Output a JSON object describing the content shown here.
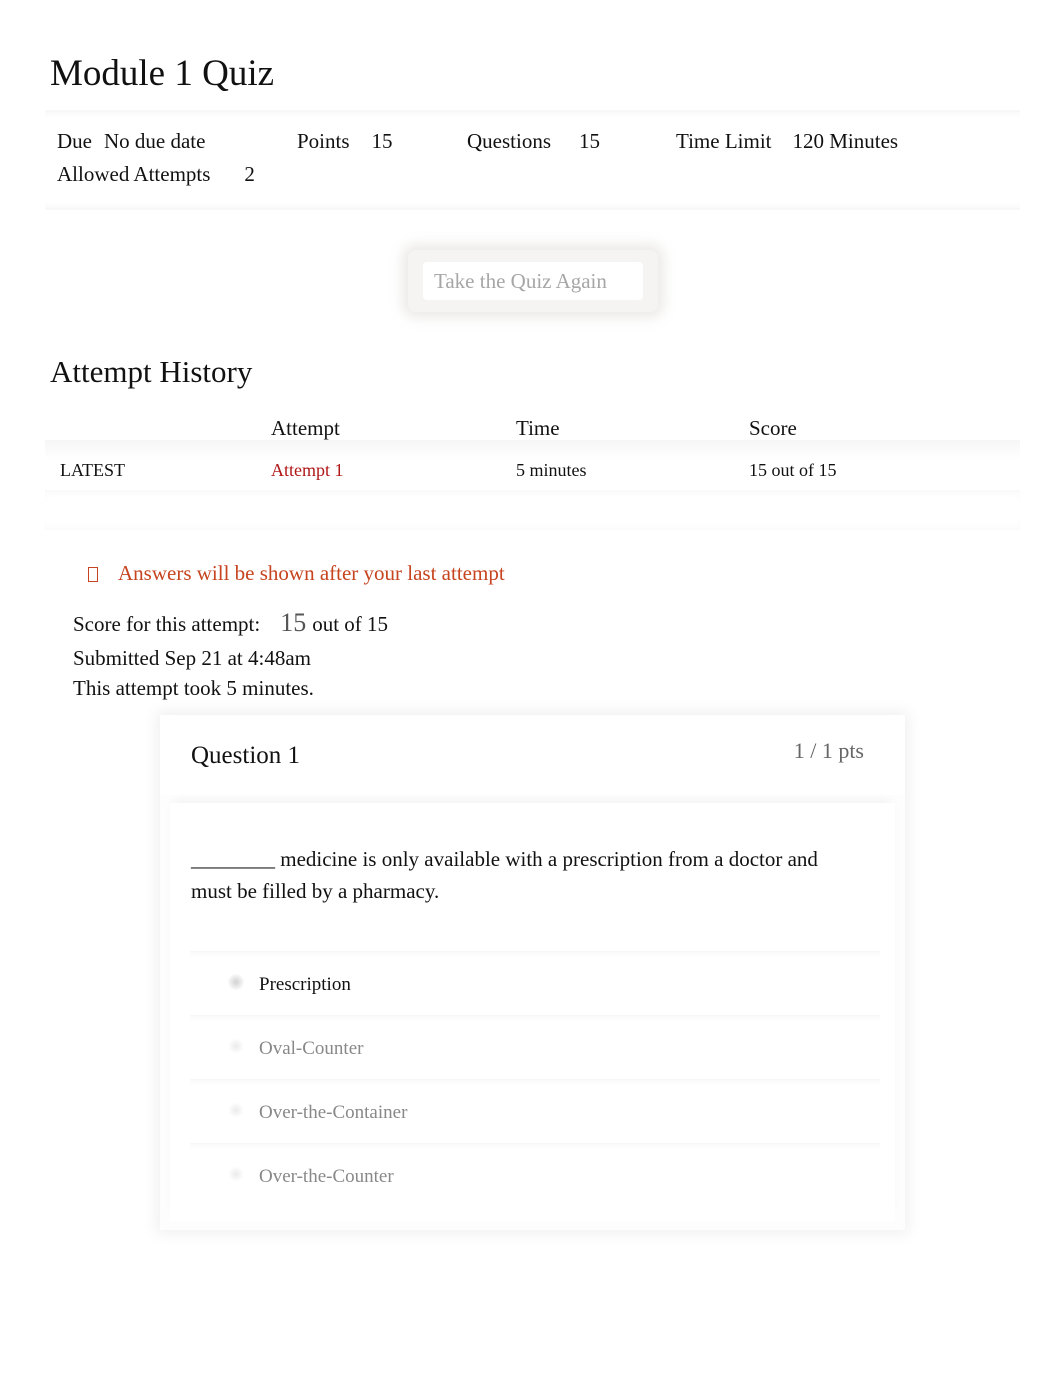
{
  "page": {
    "title": "Module 1 Quiz"
  },
  "details": [
    {
      "label": "Due",
      "value": "No due date"
    },
    {
      "label": "Points",
      "value": "15"
    },
    {
      "label": "Questions",
      "value": "15"
    },
    {
      "label": "Time Limit",
      "value": "120 Minutes"
    },
    {
      "label": "Allowed Attempts",
      "value": "2"
    }
  ],
  "actions": {
    "take_again_label": "Take the Quiz Again"
  },
  "attempt_history": {
    "heading": "Attempt History",
    "columns": [
      "",
      "Attempt",
      "Time",
      "Score"
    ],
    "rows": [
      {
        "tag": "LATEST",
        "attempt": "Attempt 1",
        "time": "5 minutes",
        "score": "15 out of 15"
      }
    ]
  },
  "notice": {
    "icon": "warning-icon",
    "text": "Answers will be shown after your last attempt",
    "color": "#c6441f"
  },
  "summary": {
    "score_label": "Score for this attempt:",
    "score_value": "15",
    "score_total": "out of 15",
    "submitted": "Submitted Sep 21 at 4:48am",
    "duration": "This attempt took 5 minutes."
  },
  "question": {
    "title": "Question 1",
    "points": "1 / 1 pts",
    "text": "________ medicine is only available with a prescription from a doctor and must be filled by a pharmacy.",
    "answers": [
      {
        "label": "Prescription",
        "selected": true
      },
      {
        "label": "Oval-Counter",
        "selected": false
      },
      {
        "label": "Over-the-Container",
        "selected": false
      },
      {
        "label": "Over-the-Counter",
        "selected": false
      }
    ]
  },
  "colors": {
    "link": "#b01717",
    "notice": "#c6441f"
  }
}
